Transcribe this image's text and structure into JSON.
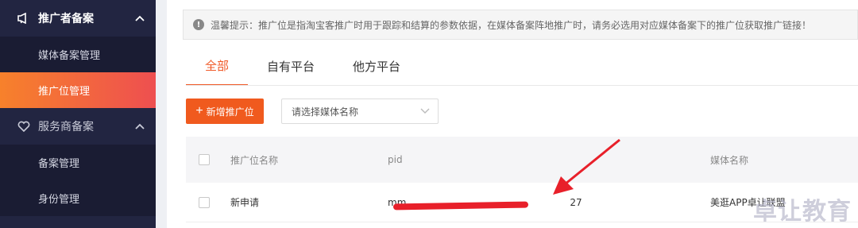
{
  "sidebar": {
    "group1_title": "推广者备案",
    "group1_items": [
      "媒体备案管理",
      "推广位管理"
    ],
    "group2_title": "服务商备案",
    "group2_items": [
      "备案管理",
      "身份管理"
    ]
  },
  "tip": {
    "text": "温馨提示：推广位是指淘宝客推广时用于跟踪和结算的参数依据，在媒体备案阵地推广时，请务必选用对应媒体备案下的推广位获取推广链接！"
  },
  "tabs": [
    "全部",
    "自有平台",
    "他方平台"
  ],
  "toolbar": {
    "add_label": "新增推广位",
    "select_placeholder": "请选择媒体名称"
  },
  "table": {
    "headers": [
      "推广位名称",
      "pid",
      "媒体名称"
    ],
    "rows": [
      {
        "name": "新申请",
        "pid": "mm_",
        "pid_tail": "27",
        "media": "美逛APP卓让联盟"
      }
    ]
  },
  "watermark": "卓让教育",
  "colors": {
    "accent": "#f05a1e",
    "sidebar_bg": "#222541"
  }
}
